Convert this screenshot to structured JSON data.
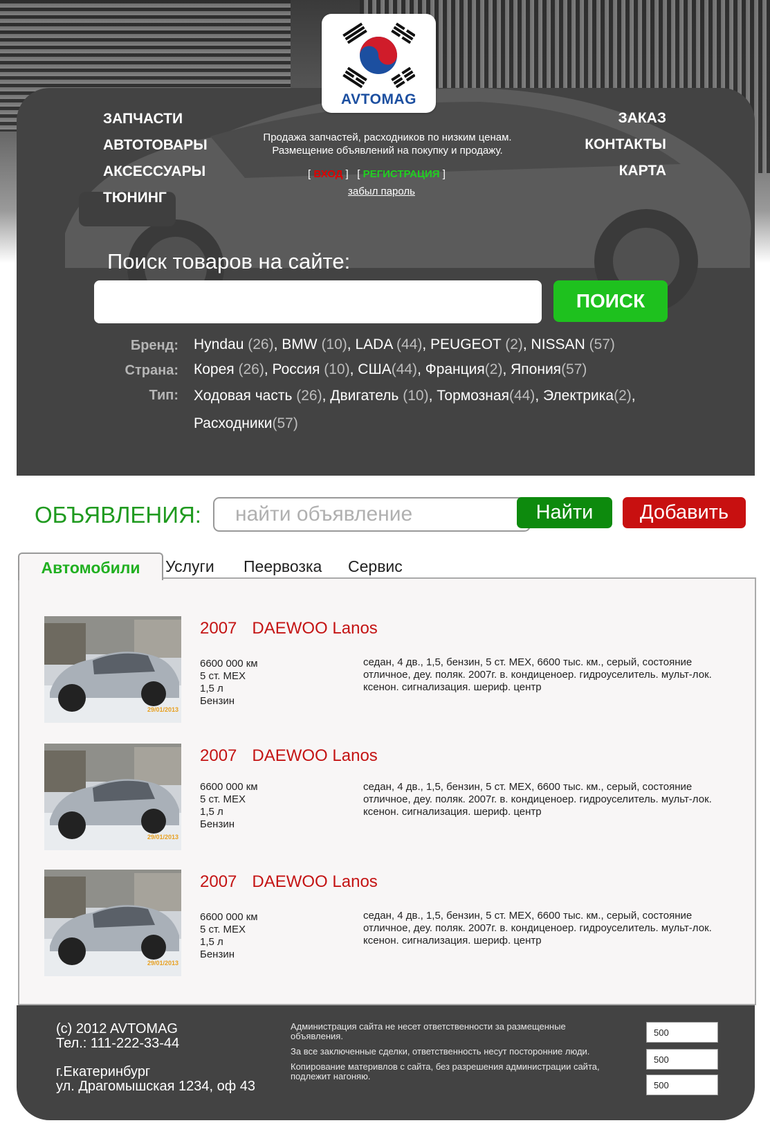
{
  "brand": {
    "logo_text": "AVTOMAG"
  },
  "nav": {
    "left": [
      "ЗАПЧАСТИ",
      "АВТОТОВАРЫ",
      "АКСЕССУАРЫ",
      "ТЮНИНГ"
    ],
    "right": [
      "ЗАКАЗ",
      "КОНТАКТЫ",
      "КАРТА"
    ]
  },
  "tagline": {
    "line1": "Продажа запчастей, расходников по низким ценам.",
    "line2": "Размещение объявлений на покупку и продажу."
  },
  "auth": {
    "login": "ВХОД",
    "register": "РЕГИСТРАЦИЯ",
    "forgot": "забыл пароль"
  },
  "search": {
    "title": "Поиск товаров на сайте:",
    "button": "ПОИСК",
    "placeholder": ""
  },
  "filters": {
    "brand": {
      "label": "Бренд:",
      "items": [
        [
          "Hyndau",
          "(26)"
        ],
        [
          "BMW",
          "(10)"
        ],
        [
          "LADA",
          "(44)"
        ],
        [
          "PEUGEOT",
          "(2)"
        ],
        [
          "NISSAN",
          "(57)"
        ]
      ]
    },
    "country": {
      "label": "Страна:",
      "items": [
        [
          "Корея",
          "(26)"
        ],
        [
          "Россия",
          "(10)"
        ],
        [
          "США",
          "(44)"
        ],
        [
          "Франция",
          "(2)"
        ],
        [
          "Япония",
          "(57)"
        ]
      ]
    },
    "type": {
      "label": "Тип:",
      "items": [
        [
          "Ходовая часть",
          "(26)"
        ],
        [
          "Двигатель",
          "(10)"
        ],
        [
          "Тормозная",
          "(44)"
        ],
        [
          "Электрика",
          "(2)"
        ],
        [
          "Расходники",
          "(57)"
        ]
      ]
    }
  },
  "ads": {
    "title": "ОБЪЯВЛЕНИЯ:",
    "placeholder": "найти объявление",
    "find_button": "Найти",
    "add_button": "Добавить"
  },
  "tabs": [
    "Автомобили",
    "Услуги",
    "Пеервозка",
    "Сервис"
  ],
  "listings": [
    {
      "year": "2007",
      "model": "DAEWOO Lanos",
      "specs": [
        "6600 000 км",
        "5 ст. МЕХ",
        "1,5 л",
        "Бензин"
      ],
      "description": "седан, 4 дв., 1,5, бензин, 5 ст. МЕХ, 6600 тыс. км., серый, состояние отличное, деу. поляк. 2007г. в. кондиценоер. гидроуселитель. мульт-лок. ксенон. сигнализация. шериф. центр",
      "photo_date": "29/01/2013"
    },
    {
      "year": "2007",
      "model": "DAEWOO Lanos",
      "specs": [
        "6600 000 км",
        "5 ст. МЕХ",
        "1,5 л",
        "Бензин"
      ],
      "description": "седан, 4 дв., 1,5, бензин, 5 ст. МЕХ, 6600 тыс. км., серый, состояние отличное, деу. поляк. 2007г. в. кондиценоер. гидроуселитель. мульт-лок. ксенон. сигнализация. шериф. центр",
      "photo_date": "29/01/2013"
    },
    {
      "year": "2007",
      "model": "DAEWOO Lanos",
      "specs": [
        "6600 000 км",
        "5 ст. МЕХ",
        "1,5 л",
        "Бензин"
      ],
      "description": "седан, 4 дв., 1,5, бензин, 5 ст. МЕХ, 6600 тыс. км., серый, состояние отличное, деу. поляк. 2007г. в. кондиценоер. гидроуселитель. мульт-лок. ксенон. сигнализация. шериф. центр",
      "photo_date": "29/01/2013"
    }
  ],
  "footer": {
    "copyright": "(c) 2012 AVTOMAG",
    "phone": "Тел.: 111-222-33-44",
    "city": "г.Екатеринбург",
    "address": "ул. Драгомышская 1234, оф 43",
    "disclaimers": [
      "Администрация сайта не несет ответственности за размещенные объявления.",
      "За все заключенные сделки, ответственность несут посторонние люди.",
      "Копирование материвлов с сайта, без разрешения администрации сайта, подлежит нагоняю."
    ],
    "counters": [
      "500",
      "500",
      "500"
    ]
  },
  "colors": {
    "panel": "#434343",
    "accent_green": "#1ec11e",
    "ads_green": "#1f9a1f",
    "find_green": "#0d8a0d",
    "add_red": "#c81010",
    "title_red": "#c41414",
    "logo_blue": "#1c4fa0"
  }
}
